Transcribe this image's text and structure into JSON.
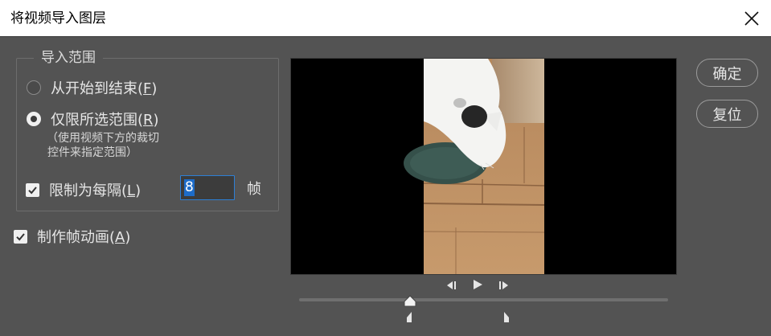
{
  "window": {
    "title": "将视频导入图层",
    "close_icon": "close-icon"
  },
  "range_group": {
    "legend": "导入范围",
    "options": [
      {
        "label": "从开始到结束(",
        "key": "F",
        "suffix": ")",
        "selected": false
      },
      {
        "label": "仅限所选范围(",
        "key": "R",
        "suffix": ")",
        "selected": true
      }
    ],
    "hint_line1": "（使用视频下方的裁切",
    "hint_line2": "控件来指定范围）",
    "limit": {
      "label": "限制为每隔(",
      "key": "L",
      "suffix": ")",
      "checked": true,
      "value": "8",
      "unit": "帧"
    }
  },
  "make_animation": {
    "label": "制作帧动画(",
    "key": "A",
    "suffix": ")",
    "checked": true
  },
  "buttons": {
    "ok": "确定",
    "reset": "复位"
  },
  "player": {
    "controls": [
      "step-back-icon",
      "play-icon",
      "step-forward-icon"
    ],
    "playhead_fraction": 0.3,
    "range_start_fraction": 0.3,
    "range_end_fraction": 0.56
  },
  "colors": {
    "dialog_bg": "#535353",
    "accent": "#2d7fd5",
    "preview_bg": "#000000"
  }
}
